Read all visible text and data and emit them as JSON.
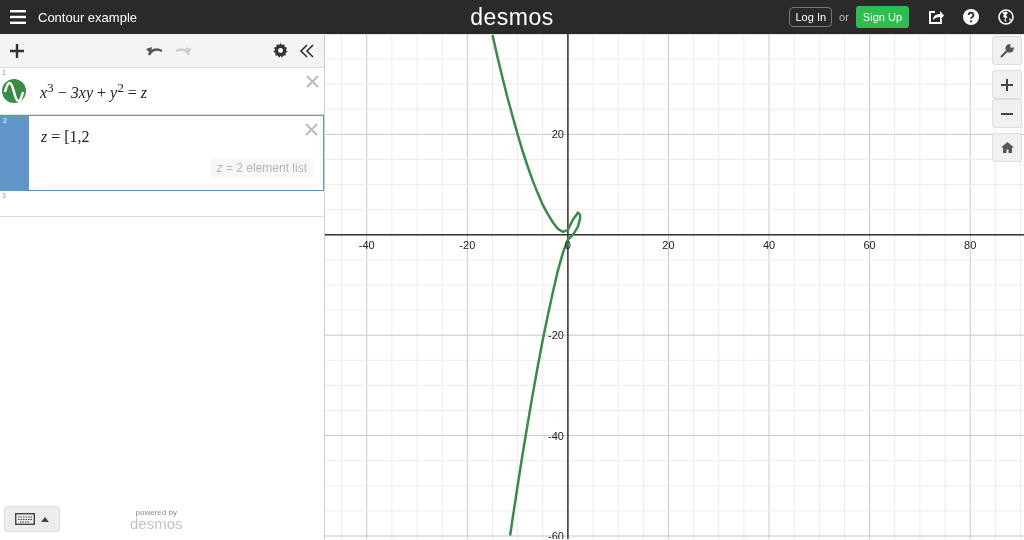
{
  "header": {
    "title": "Contour example",
    "logo": "desmos",
    "login": "Log In",
    "or": "or",
    "signup": "Sign Up"
  },
  "history": [
    {
      "kind": "undo",
      "disabled": false
    },
    {
      "kind": "redo",
      "disabled": true
    }
  ],
  "expressions": [
    {
      "number": "1",
      "latex": "*x*$^{3}$ − *3xy* + *y*$^{2}$ = *z*",
      "selected": false,
      "color": "#388c46"
    },
    {
      "number": "2",
      "latex": "*z* = [1,2",
      "hint": "*z* = 2 element list",
      "selected": true
    },
    {
      "number": "3",
      "selected": false
    }
  ],
  "footer": {
    "powered": "powered by",
    "brand": "desmos"
  },
  "graph": {
    "chart_data": {
      "type": "line",
      "grid": true,
      "xlim": [
        -48.3,
        90.7
      ],
      "ylim": [
        -60.6,
        40
      ],
      "xticks": [
        -40,
        -20,
        0,
        20,
        40,
        60,
        80
      ],
      "yticks": [
        -60,
        -40,
        -20,
        20
      ],
      "x": [
        -15,
        -14,
        -13,
        -12,
        -11,
        -10,
        -9,
        -8,
        -7,
        -6,
        -5,
        -4,
        -3,
        -2,
        -1,
        0,
        1,
        2,
        2.4,
        2.42,
        2.42,
        2.4,
        2,
        1,
        0,
        -1,
        -2,
        -3,
        -4,
        -5,
        -6,
        -7,
        -8,
        -9,
        -10,
        -11,
        -11.5
      ],
      "series": [
        {
          "color": "#388c46",
          "values": [
            39.8,
            35.4,
            31.3,
            27.3,
            23.6,
            20,
            16.7,
            13.6,
            10.8,
            8.3,
            6,
            4.1,
            2.5,
            1.2,
            0.6,
            1,
            3,
            4.4,
            4,
            3.7,
            3.6,
            3.2,
            1.6,
            0,
            -1,
            -3.6,
            -7.2,
            -11.5,
            -16.1,
            -21,
            -26.3,
            -31.8,
            -37.6,
            -43.7,
            -50,
            -56.6,
            -59.9
          ]
        }
      ]
    }
  }
}
